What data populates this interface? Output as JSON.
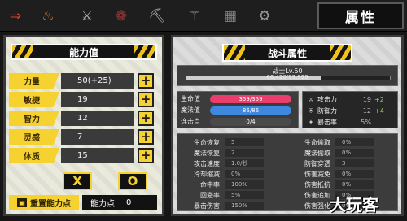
{
  "topbar": {
    "icons": [
      {
        "name": "exit-arrow-icon",
        "glyph": "⇒",
        "color": "#e0402a"
      },
      {
        "name": "bag-icon",
        "glyph": "♨",
        "color": "#d9772c"
      },
      {
        "name": "sword-icon",
        "glyph": "⚔",
        "color": "#b0b0b0"
      },
      {
        "name": "pouch-icon",
        "glyph": "❁",
        "color": "#9a3a3a"
      },
      {
        "name": "pickaxe-icon",
        "glyph": "⛏",
        "color": "#b0b0b0"
      },
      {
        "name": "wand-icon",
        "glyph": "⚚",
        "color": "#9090a0"
      },
      {
        "name": "chest-icon",
        "glyph": "▦",
        "color": "#808080"
      },
      {
        "name": "gear-icon",
        "glyph": "⚙",
        "color": "#9a9a9a"
      }
    ],
    "title": "属性"
  },
  "left": {
    "header": "能力值",
    "stats": [
      {
        "label": "力量",
        "value": "50(+25)"
      },
      {
        "label": "敏捷",
        "value": "19"
      },
      {
        "label": "智力",
        "value": "12"
      },
      {
        "label": "灵感",
        "value": "7"
      },
      {
        "label": "体质",
        "value": "15"
      }
    ],
    "plus": "+",
    "cancel_glyph": "X",
    "confirm_glyph": "O",
    "reset_label": "重置能力点",
    "points_label": "能力点",
    "points_value": "0"
  },
  "right": {
    "header": "战斗属性",
    "level_text": "战士Lv.50",
    "xp_text": "66,420/99,999",
    "xp_fraction": 0.66,
    "vitals": [
      {
        "label": "生命值",
        "value": "359/359",
        "color": "#ea3f6d"
      },
      {
        "label": "魔法值",
        "value": "86/86",
        "color": "#3f88e0"
      },
      {
        "label": "连击点",
        "value": "0/4",
        "color": "#4a4a4a"
      }
    ],
    "atkdef": [
      {
        "icon": "⚔",
        "icon_name": "attack-icon",
        "label": "攻击力",
        "value": "19",
        "bonus": "+2"
      },
      {
        "icon": "⛨",
        "icon_name": "defense-icon",
        "label": "防御力",
        "value": "12",
        "bonus": "+4"
      },
      {
        "icon": "✦",
        "icon_name": "crit-icon",
        "label": "暴击率",
        "value": "5%",
        "bonus": ""
      }
    ],
    "sub_left": [
      {
        "label": "生命恢复",
        "value": "5"
      },
      {
        "label": "魔法恢复",
        "value": "2"
      },
      {
        "label": "攻击速度",
        "value": "1.0/秒"
      },
      {
        "label": "冷却缩减",
        "value": "0%"
      },
      {
        "label": "命中率",
        "value": "100%"
      },
      {
        "label": "回避率",
        "value": "5%"
      },
      {
        "label": "暴击伤害",
        "value": "150%"
      }
    ],
    "sub_right": [
      {
        "label": "生命偷取",
        "value": "0%"
      },
      {
        "label": "魔法偷取",
        "value": "0%"
      },
      {
        "label": "防御穿透",
        "value": "3"
      },
      {
        "label": "伤害减免",
        "value": "0%"
      },
      {
        "label": "伤害抵抗",
        "value": "0%"
      },
      {
        "label": "伤害追加",
        "value": "0%"
      },
      {
        "label": "伤害强化",
        "value": "0%"
      }
    ]
  },
  "watermark": "大玩客"
}
